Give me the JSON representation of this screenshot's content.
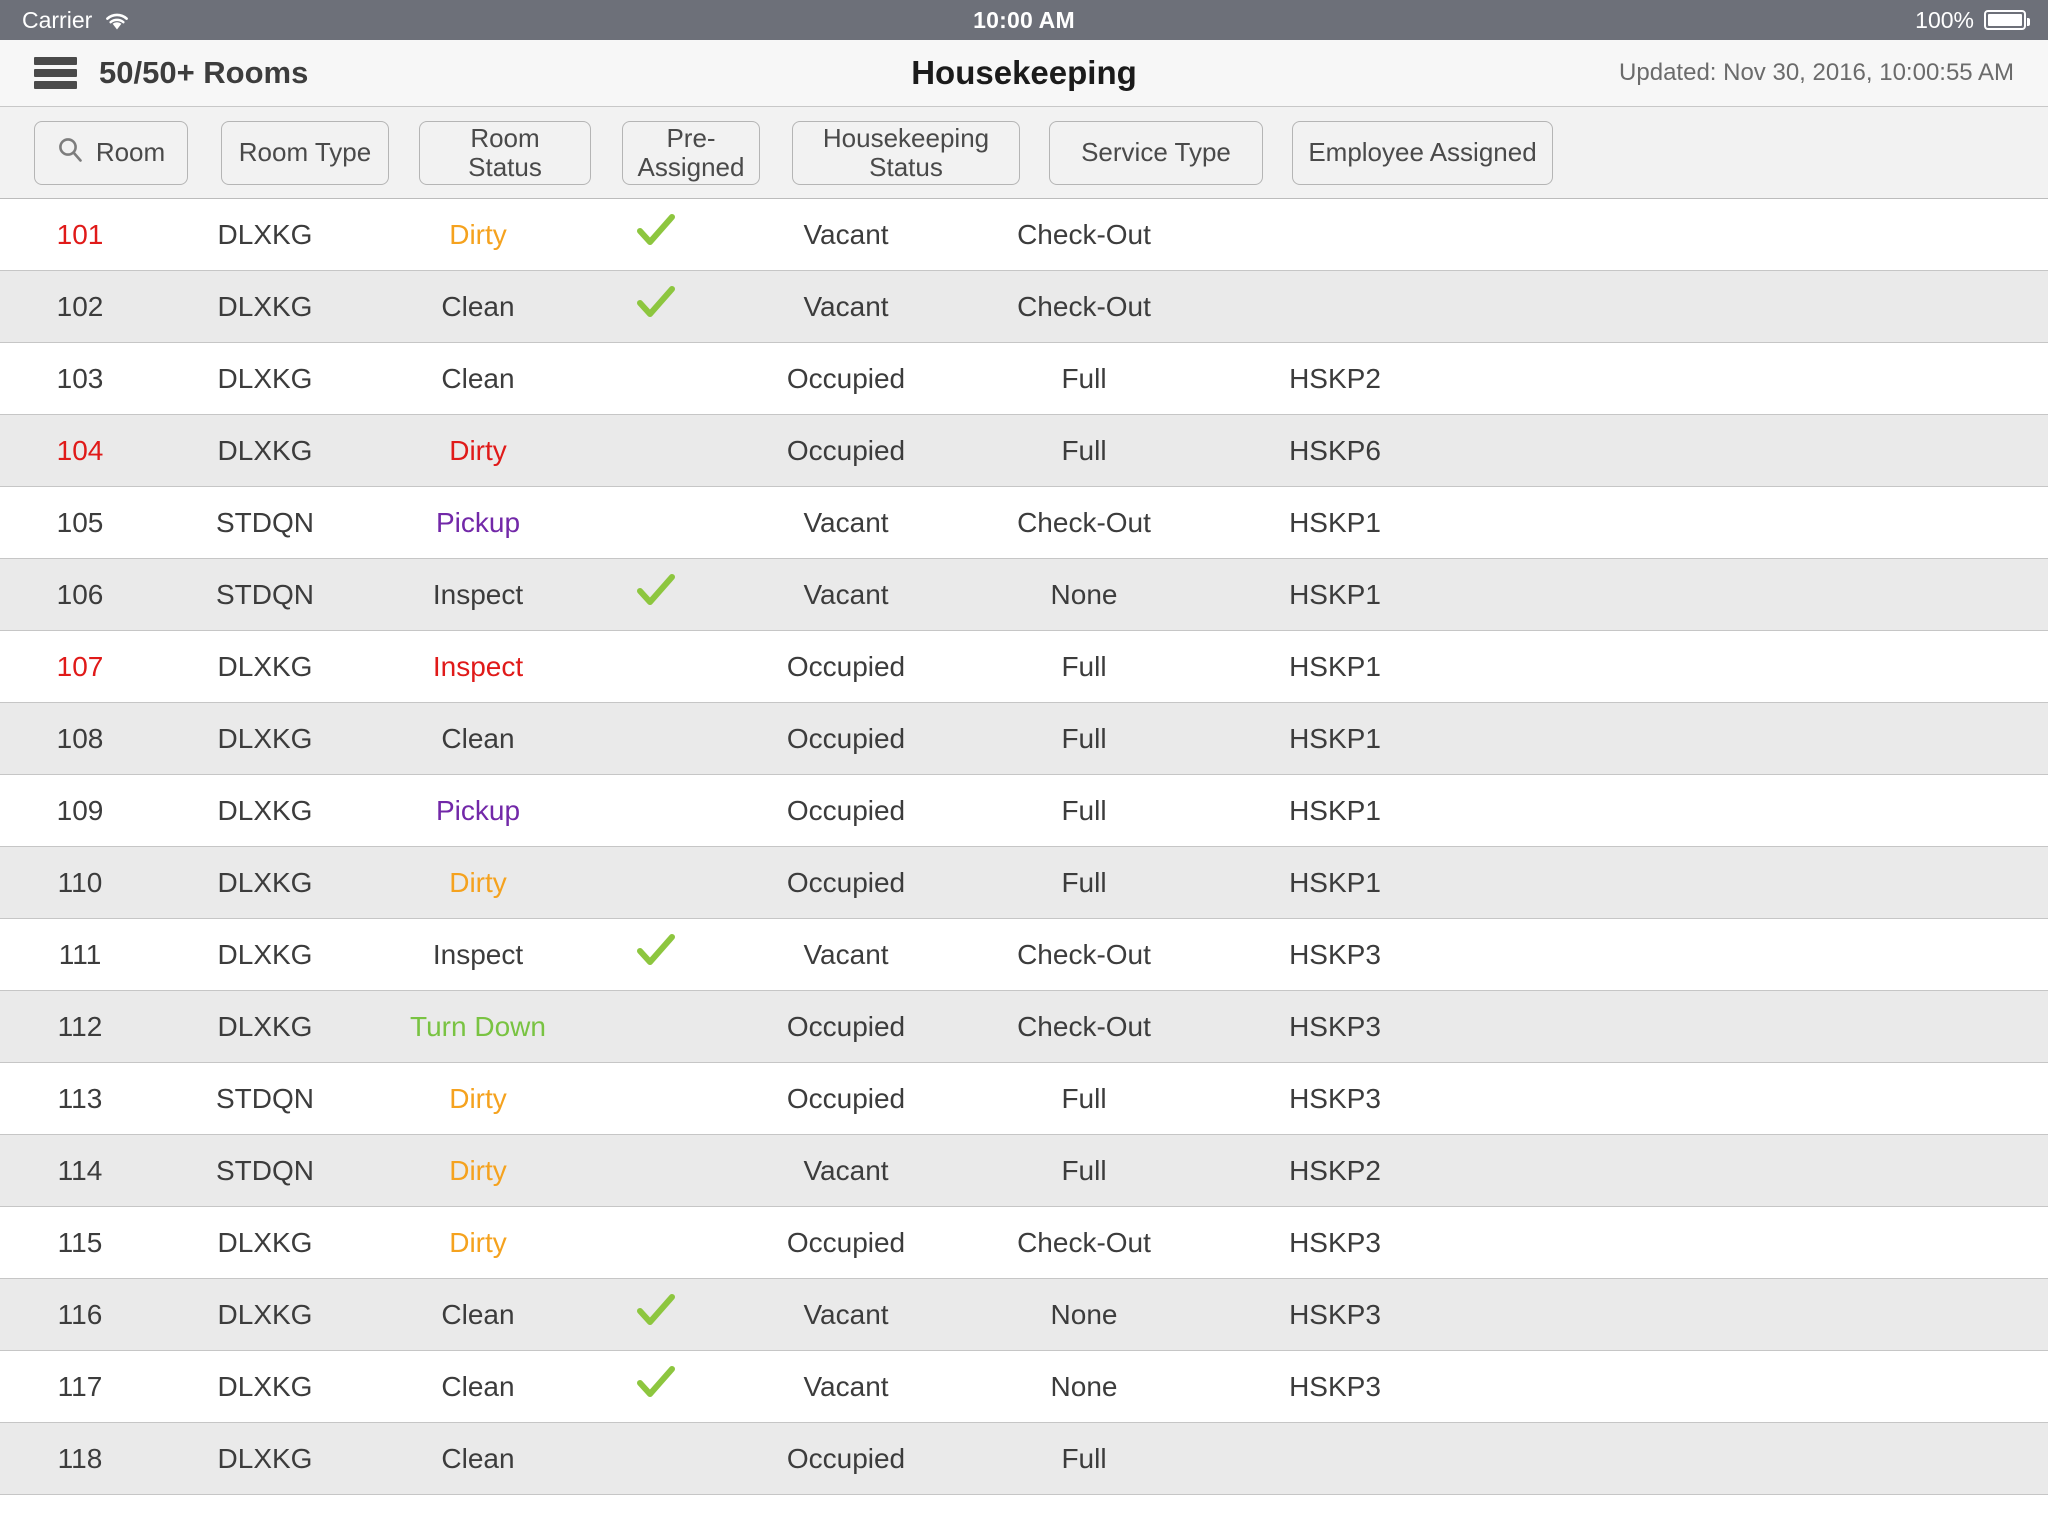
{
  "status_bar": {
    "carrier": "Carrier",
    "time": "10:00 AM",
    "battery_percent": "100%",
    "wifi_icon": "wifi-icon",
    "battery_icon": "battery-icon"
  },
  "header": {
    "menu_icon": "hamburger-menu-icon",
    "rooms_count": "50/50+ Rooms",
    "title": "Housekeeping",
    "updated": "Updated: Nov 30, 2016, 10:00:55 AM"
  },
  "filters": [
    {
      "key": "room",
      "label": "Room",
      "icon": "search-icon"
    },
    {
      "key": "room_type",
      "label": "Room Type",
      "icon": null
    },
    {
      "key": "room_status",
      "label": "Room Status",
      "icon": null
    },
    {
      "key": "pre_assigned",
      "label": "Pre-\nAssigned",
      "icon": null
    },
    {
      "key": "hk_status",
      "label": "Housekeeping\nStatus",
      "icon": null
    },
    {
      "key": "service_type",
      "label": "Service Type",
      "icon": null
    },
    {
      "key": "employee",
      "label": "Employee Assigned",
      "icon": null
    }
  ],
  "colors": {
    "dirty": "#f5a21e",
    "pickup": "#7228a8",
    "turn_down": "#79c342",
    "alert_red": "#e01a19",
    "normal_text": "#3c3c3c",
    "check_green": "#8dc63f",
    "statusbar_bg": "#6d7079",
    "navbar_bg": "#f7f7f7",
    "filterbar_bg": "#f2f2f2",
    "row_alt_bg": "#eaeaea"
  },
  "table": {
    "columns": [
      "Room",
      "Room Type",
      "Room Status",
      "Pre-Assigned",
      "Housekeeping Status",
      "Service Type",
      "Employee Assigned"
    ],
    "check_icon": "check-icon",
    "rows": [
      {
        "room": "101",
        "room_alert": true,
        "room_type": "DLXKG",
        "room_status": "Dirty",
        "status_style": "dirty",
        "pre_assigned": true,
        "hk_status": "Vacant",
        "service_type": "Check-Out",
        "employee": ""
      },
      {
        "room": "102",
        "room_alert": false,
        "room_type": "DLXKG",
        "room_status": "Clean",
        "status_style": "normal",
        "pre_assigned": true,
        "hk_status": "Vacant",
        "service_type": "Check-Out",
        "employee": ""
      },
      {
        "room": "103",
        "room_alert": false,
        "room_type": "DLXKG",
        "room_status": "Clean",
        "status_style": "normal",
        "pre_assigned": false,
        "hk_status": "Occupied",
        "service_type": "Full",
        "employee": "HSKP2"
      },
      {
        "room": "104",
        "room_alert": true,
        "room_type": "DLXKG",
        "room_status": "Dirty",
        "status_style": "red",
        "pre_assigned": false,
        "hk_status": "Occupied",
        "service_type": "Full",
        "employee": "HSKP6"
      },
      {
        "room": "105",
        "room_alert": false,
        "room_type": "STDQN",
        "room_status": "Pickup",
        "status_style": "pickup",
        "pre_assigned": false,
        "hk_status": "Vacant",
        "service_type": "Check-Out",
        "employee": "HSKP1"
      },
      {
        "room": "106",
        "room_alert": false,
        "room_type": "STDQN",
        "room_status": "Inspect",
        "status_style": "normal",
        "pre_assigned": true,
        "hk_status": "Vacant",
        "service_type": "None",
        "employee": "HSKP1"
      },
      {
        "room": "107",
        "room_alert": true,
        "room_type": "DLXKG",
        "room_status": "Inspect",
        "status_style": "red",
        "pre_assigned": false,
        "hk_status": "Occupied",
        "service_type": "Full",
        "employee": "HSKP1"
      },
      {
        "room": "108",
        "room_alert": false,
        "room_type": "DLXKG",
        "room_status": "Clean",
        "status_style": "normal",
        "pre_assigned": false,
        "hk_status": "Occupied",
        "service_type": "Full",
        "employee": "HSKP1"
      },
      {
        "room": "109",
        "room_alert": false,
        "room_type": "DLXKG",
        "room_status": "Pickup",
        "status_style": "pickup",
        "pre_assigned": false,
        "hk_status": "Occupied",
        "service_type": "Full",
        "employee": "HSKP1"
      },
      {
        "room": "110",
        "room_alert": false,
        "room_type": "DLXKG",
        "room_status": "Dirty",
        "status_style": "dirty",
        "pre_assigned": false,
        "hk_status": "Occupied",
        "service_type": "Full",
        "employee": "HSKP1"
      },
      {
        "room": "111",
        "room_alert": false,
        "room_type": "DLXKG",
        "room_status": "Inspect",
        "status_style": "normal",
        "pre_assigned": true,
        "hk_status": "Vacant",
        "service_type": "Check-Out",
        "employee": "HSKP3"
      },
      {
        "room": "112",
        "room_alert": false,
        "room_type": "DLXKG",
        "room_status": "Turn Down",
        "status_style": "turndown",
        "pre_assigned": false,
        "hk_status": "Occupied",
        "service_type": "Check-Out",
        "employee": "HSKP3"
      },
      {
        "room": "113",
        "room_alert": false,
        "room_type": "STDQN",
        "room_status": "Dirty",
        "status_style": "dirty",
        "pre_assigned": false,
        "hk_status": "Occupied",
        "service_type": "Full",
        "employee": "HSKP3"
      },
      {
        "room": "114",
        "room_alert": false,
        "room_type": "STDQN",
        "room_status": "Dirty",
        "status_style": "dirty",
        "pre_assigned": false,
        "hk_status": "Vacant",
        "service_type": "Full",
        "employee": "HSKP2"
      },
      {
        "room": "115",
        "room_alert": false,
        "room_type": "DLXKG",
        "room_status": "Dirty",
        "status_style": "dirty",
        "pre_assigned": false,
        "hk_status": "Occupied",
        "service_type": "Check-Out",
        "employee": "HSKP3"
      },
      {
        "room": "116",
        "room_alert": false,
        "room_type": "DLXKG",
        "room_status": "Clean",
        "status_style": "normal",
        "pre_assigned": true,
        "hk_status": "Vacant",
        "service_type": "None",
        "employee": "HSKP3"
      },
      {
        "room": "117",
        "room_alert": false,
        "room_type": "DLXKG",
        "room_status": "Clean",
        "status_style": "normal",
        "pre_assigned": true,
        "hk_status": "Vacant",
        "service_type": "None",
        "employee": "HSKP3"
      },
      {
        "room": "118",
        "room_alert": false,
        "room_type": "DLXKG",
        "room_status": "Clean",
        "status_style": "normal",
        "pre_assigned": false,
        "hk_status": "Occupied",
        "service_type": "Full",
        "employee": ""
      }
    ]
  }
}
